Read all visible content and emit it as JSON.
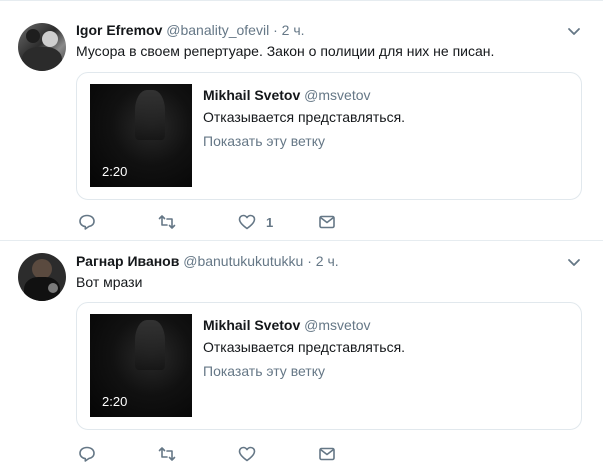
{
  "tweets": [
    {
      "author": "Igor Efremov",
      "handle": "@banality_ofevil",
      "time": "2 ч.",
      "separator": "·",
      "text": "Мусора в своем репертуаре. Закон о полиции для них не писан.",
      "quoted": {
        "author": "Mikhail Svetov",
        "handle": "@msvetov",
        "text": "Отказывается представляться.",
        "thread_link": "Показать эту ветку",
        "video_duration": "2:20"
      },
      "likes": "1"
    },
    {
      "author": "Рагнар Иванов",
      "handle": "@banutukukutukku",
      "time": "2 ч.",
      "separator": "·",
      "text": "Вот мрази",
      "quoted": {
        "author": "Mikhail Svetov",
        "handle": "@msvetov",
        "text": "Отказывается представляться.",
        "thread_link": "Показать эту ветку",
        "video_duration": "2:20"
      },
      "likes": ""
    }
  ],
  "icons": {
    "reply": "reply-icon",
    "retweet": "retweet-icon",
    "like": "heart-icon",
    "dm": "envelope-icon",
    "menu": "chevron-down-icon"
  },
  "colors": {
    "text": "#14171a",
    "secondary": "#657786",
    "border": "#e1e8ed",
    "divider": "#e6ecf0",
    "video_bg": "#0b0b0b"
  }
}
